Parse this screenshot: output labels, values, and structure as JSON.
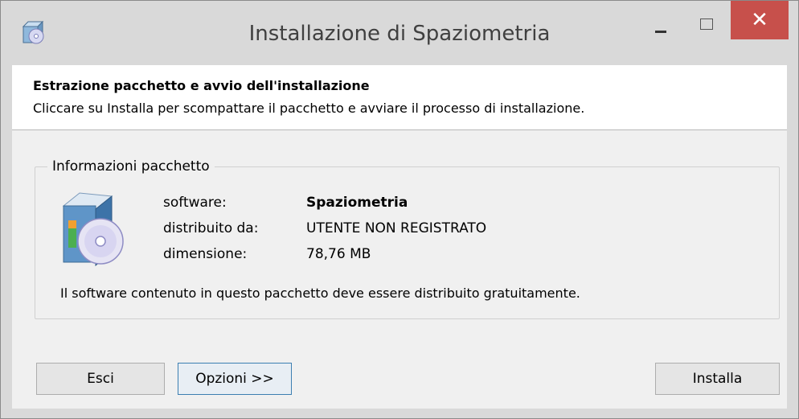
{
  "window": {
    "title": "Installazione di Spaziometria",
    "app_icon": "installer-icon",
    "controls": {
      "minimize": "minimize-icon",
      "maximize": "maximize-icon",
      "close": "close-icon",
      "close_color": "#c7504b"
    }
  },
  "header": {
    "title": "Estrazione pacchetto e avvio dell'installazione",
    "description": "Cliccare su Installa per scompattare il pacchetto e avviare il processo di installazione."
  },
  "package_info": {
    "legend": "Informazioni pacchetto",
    "icon": "software-box-cd-icon",
    "rows": [
      {
        "label": "software:",
        "value": "Spaziometria"
      },
      {
        "label": "distribuito da:",
        "value": "UTENTE NON REGISTRATO"
      },
      {
        "label": "dimensione:",
        "value": "78,76 MB"
      }
    ],
    "note": "Il software contenuto in questo pacchetto deve essere distribuito gratuitamente."
  },
  "buttons": {
    "exit": "Esci",
    "options": "Opzioni >>",
    "install": "Installa"
  }
}
